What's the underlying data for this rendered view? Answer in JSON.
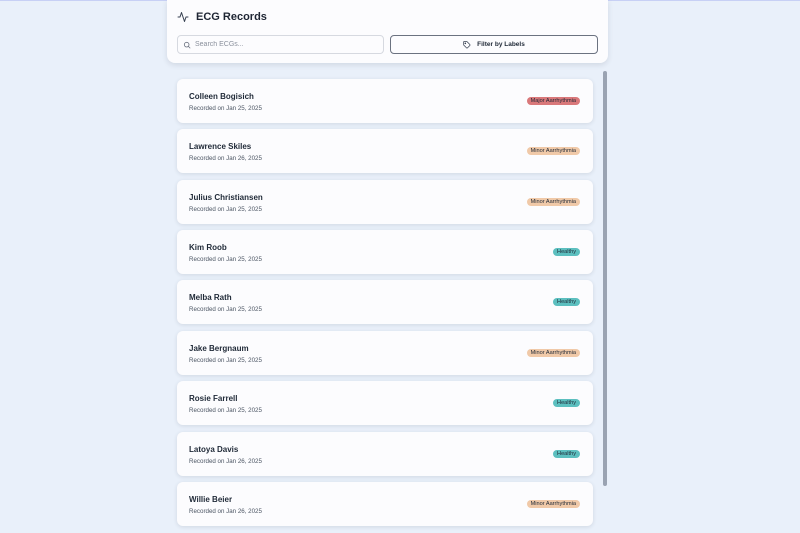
{
  "header": {
    "title": "ECG Records",
    "search_placeholder": "Search ECGs...",
    "filter_label": "Filter by Labels"
  },
  "records": [
    {
      "name": "Colleen Bogisich",
      "date": "Recorded on Jan 25, 2025",
      "label": "Major Aarrhythmia",
      "color": "#d9787a"
    },
    {
      "name": "Lawrence Skiles",
      "date": "Recorded on Jan 26, 2025",
      "label": "Minor Aarrhythmia",
      "color": "#f0c9a8"
    },
    {
      "name": "Julius Christiansen",
      "date": "Recorded on Jan 25, 2025",
      "label": "Minor Aarrhythmia",
      "color": "#f0c9a8"
    },
    {
      "name": "Kim Roob",
      "date": "Recorded on Jan 25, 2025",
      "label": "Healthy",
      "color": "#5cbfbf"
    },
    {
      "name": "Melba Rath",
      "date": "Recorded on Jan 25, 2025",
      "label": "Healthy",
      "color": "#5cbfbf"
    },
    {
      "name": "Jake Bergnaum",
      "date": "Recorded on Jan 25, 2025",
      "label": "Minor Aarrhythmia",
      "color": "#f0c9a8"
    },
    {
      "name": "Rosie Farrell",
      "date": "Recorded on Jan 25, 2025",
      "label": "Healthy",
      "color": "#5cbfbf"
    },
    {
      "name": "Latoya Davis",
      "date": "Recorded on Jan 26, 2025",
      "label": "Healthy",
      "color": "#5cbfbf"
    },
    {
      "name": "Willie Beier",
      "date": "Recorded on Jan 26, 2025",
      "label": "Minor Aarrhythmia",
      "color": "#f0c9a8"
    }
  ]
}
